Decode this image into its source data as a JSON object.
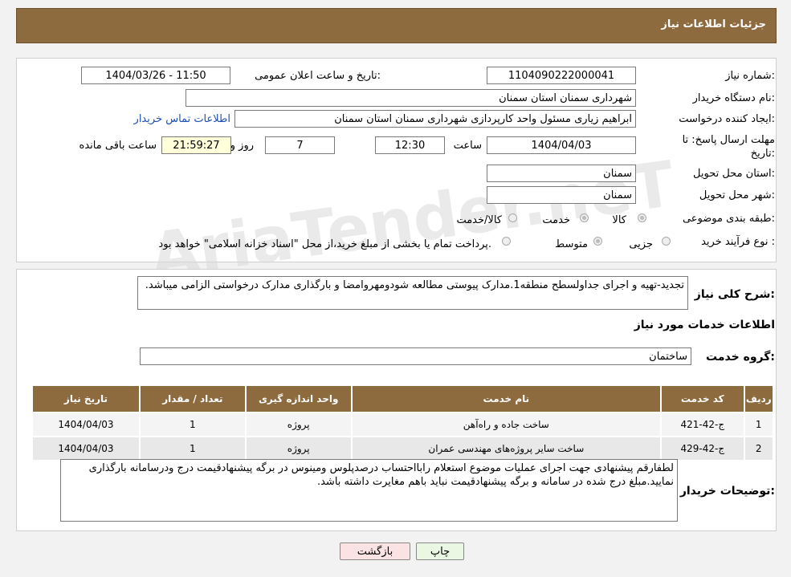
{
  "header": {
    "title": "جزئیات اطلاعات نیاز"
  },
  "need_number": {
    "label": "شماره نیاز:",
    "value": "1104090222000041"
  },
  "announce": {
    "label": "تاریخ و ساعت اعلان عمومی:",
    "value": "1404/03/26 - 11:50"
  },
  "buyer_org": {
    "label": "نام دستگاه خریدار:",
    "value": "شهرداری سمنان استان سمنان"
  },
  "creator": {
    "label": "ایجاد کننده درخواست:",
    "value": "ابراهیم زیاری مسئول واحد کارپردازی شهرداری سمنان استان سمنان",
    "contact_link": "اطلاعات تماس خریدار"
  },
  "deadline": {
    "label_line1": "مهلت ارسال پاسخ: تا",
    "label_line2": "تاریخ:",
    "date": "1404/04/03",
    "time_label": "ساعت",
    "time": "12:30",
    "days": "7",
    "days_label": "روز و",
    "remaining": "21:59:27",
    "remaining_label": "ساعت باقی مانده"
  },
  "province": {
    "label": "استان محل تحویل:",
    "value": "سمنان"
  },
  "city": {
    "label": "شهر محل تحویل:",
    "value": "سمنان"
  },
  "category": {
    "label": "طبقه بندی موضوعی:",
    "options": [
      "کالا",
      "خدمت",
      "کالا/خدمت"
    ]
  },
  "purchase_type": {
    "label": "نوع فرآیند خرید :",
    "options": [
      "جزیی",
      "متوسط"
    ],
    "note": "پرداخت تمام یا بخشی از مبلغ خرید،از محل \"اسناد خزانه اسلامی\" خواهد بود."
  },
  "description": {
    "label": "شرح کلی نیاز:",
    "value": "تجدید-تهیه و اجرای جداولسطح منطقه1.مدارک پیوستی مطالعه شودومهروامضا و بارگذاری مدارک درخواستی الزامی میباشد."
  },
  "services": {
    "section_title": "اطلاعات خدمات مورد نیاز",
    "group_label": "گروه خدمت:",
    "group_value": "ساختمان",
    "columns": [
      "ردیف",
      "کد خدمت",
      "نام خدمت",
      "واحد اندازه گیری",
      "تعداد / مقدار",
      "تاریخ نیاز"
    ],
    "rows": [
      [
        "1",
        "ج-42-421",
        "ساخت جاده و راه‌آهن",
        "پروژه",
        "1",
        "1404/04/03"
      ],
      [
        "2",
        "ج-42-429",
        "ساخت سایر پروژه‌های مهندسی عمران",
        "پروژه",
        "1",
        "1404/04/03"
      ]
    ]
  },
  "buyer_notes": {
    "label": "توضیحات خریدار:",
    "value": "لطفارقم پیشنهادی جهت اجرای عملیات موضوع استعلام رابااحتساب درصدپلوس ومینوس در برگه پیشنهادقیمت درج ودرسامانه بارگذاری نمایید.مبلغ درج شده در سامانه و برگه پیشنهادقیمت نباید باهم مغایرت داشته باشد."
  },
  "buttons": {
    "print": "چاپ",
    "back": "بازگشت"
  },
  "colors": {
    "header_bg": "#8d6b3f",
    "print_bg": "#e9f7e3",
    "back_bg": "#fbe3e3"
  }
}
